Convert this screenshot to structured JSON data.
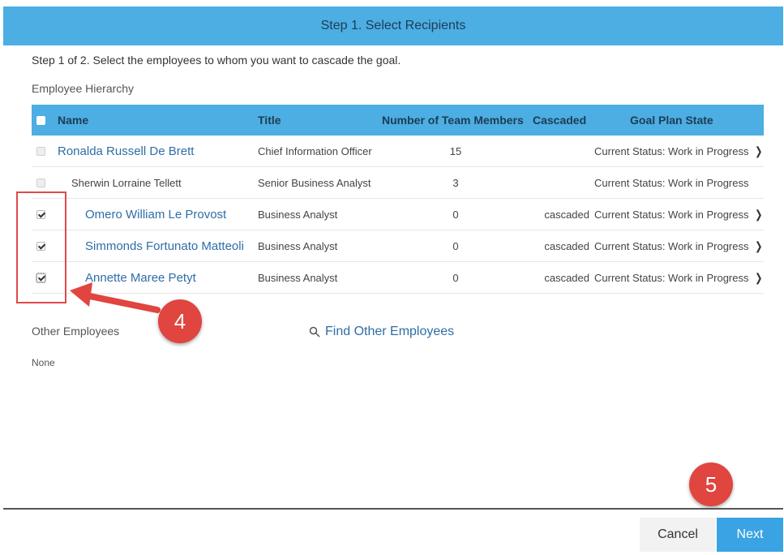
{
  "header": {
    "title": "Step 1. Select Recipients"
  },
  "instruction": "Step 1 of 2. Select the employees to whom you want to cascade the goal.",
  "hierarchy_label": "Employee Hierarchy",
  "table": {
    "columns": {
      "name": "Name",
      "title": "Title",
      "team_members": "Number of Team Members",
      "cascaded": "Cascaded",
      "state": "Goal Plan State"
    },
    "rows": [
      {
        "name": "Ronalda Russell De Brett",
        "title": "Chief Information Officer",
        "team_members": "15",
        "cascaded": "",
        "state": "Current Status: Work in Progress",
        "checked": false
      },
      {
        "name": "Sherwin Lorraine Tellett",
        "title": "Senior Business Analyst",
        "team_members": "3",
        "cascaded": "",
        "state": "Current Status: Work in Progress",
        "checked": false
      },
      {
        "name": "Omero William Le Provost",
        "title": "Business Analyst",
        "team_members": "0",
        "cascaded": "cascaded",
        "state": "Current Status: Work in Progress",
        "checked": true
      },
      {
        "name": "Simmonds Fortunato Matteoli",
        "title": "Business Analyst",
        "team_members": "0",
        "cascaded": "cascaded",
        "state": "Current Status: Work in Progress",
        "checked": true
      },
      {
        "name": "Annette Maree Petyt",
        "title": "Business Analyst",
        "team_members": "0",
        "cascaded": "cascaded",
        "state": "Current Status: Work in Progress",
        "checked": true
      }
    ]
  },
  "annotations": {
    "badge_4": "4",
    "badge_5": "5"
  },
  "other_employees": {
    "label": "Other Employees",
    "find_link": "Find Other Employees",
    "none": "None"
  },
  "buttons": {
    "cancel": "Cancel",
    "next": "Next"
  },
  "colors": {
    "header": "#4caee2",
    "link": "#2e6ea6",
    "badge": "#e0453f",
    "primary_button": "#3aa3e3"
  }
}
